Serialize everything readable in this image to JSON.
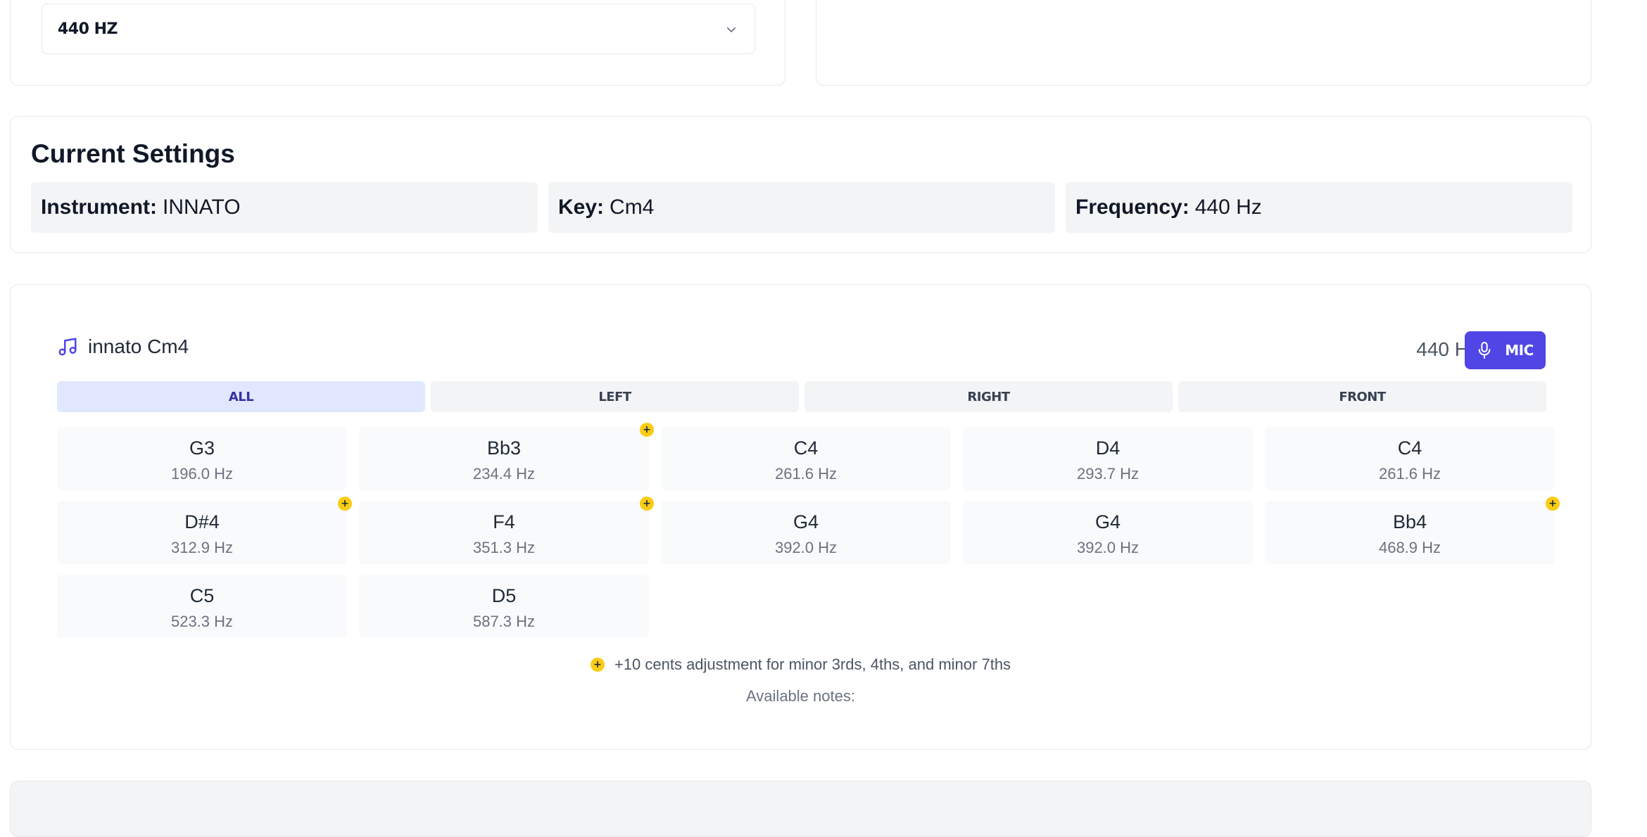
{
  "reference_select": {
    "value": "440 HZ"
  },
  "settings": {
    "title": "Current Settings",
    "instrument_label": "Instrument:",
    "instrument_value": "INNATO",
    "key_label": "Key:",
    "key_value": "Cm4",
    "frequency_label": "Frequency:",
    "frequency_value": "440 Hz"
  },
  "tuner": {
    "title": "innato Cm4",
    "hz": "440 Hz",
    "mic_label": "MIC",
    "tabs": [
      {
        "label": "ALL",
        "active": true
      },
      {
        "label": "LEFT",
        "active": false
      },
      {
        "label": "RIGHT",
        "active": false
      },
      {
        "label": "FRONT",
        "active": false
      }
    ],
    "notes": [
      {
        "name": "G3",
        "freq": "196.0 Hz",
        "adjusted": false
      },
      {
        "name": "Bb3",
        "freq": "234.4 Hz",
        "adjusted": true
      },
      {
        "name": "C4",
        "freq": "261.6 Hz",
        "adjusted": false
      },
      {
        "name": "D4",
        "freq": "293.7 Hz",
        "adjusted": false
      },
      {
        "name": "C4",
        "freq": "261.6 Hz",
        "adjusted": false
      },
      {
        "name": "D#4",
        "freq": "312.9 Hz",
        "adjusted": true
      },
      {
        "name": "F4",
        "freq": "351.3 Hz",
        "adjusted": true
      },
      {
        "name": "G4",
        "freq": "392.0 Hz",
        "adjusted": false
      },
      {
        "name": "G4",
        "freq": "392.0 Hz",
        "adjusted": false
      },
      {
        "name": "Bb4",
        "freq": "468.9 Hz",
        "adjusted": true
      },
      {
        "name": "C5",
        "freq": "523.3 Hz",
        "adjusted": false
      },
      {
        "name": "D5",
        "freq": "587.3 Hz",
        "adjusted": false
      }
    ],
    "badge_symbol": "+",
    "legend": "+10 cents adjustment for minor 3rds, 4ths, and minor 7ths",
    "available_notes": "Available notes:"
  },
  "colors": {
    "accent": "#4f46e5",
    "tab_active_bg": "#e0e7ff",
    "badge": "#facc15"
  }
}
